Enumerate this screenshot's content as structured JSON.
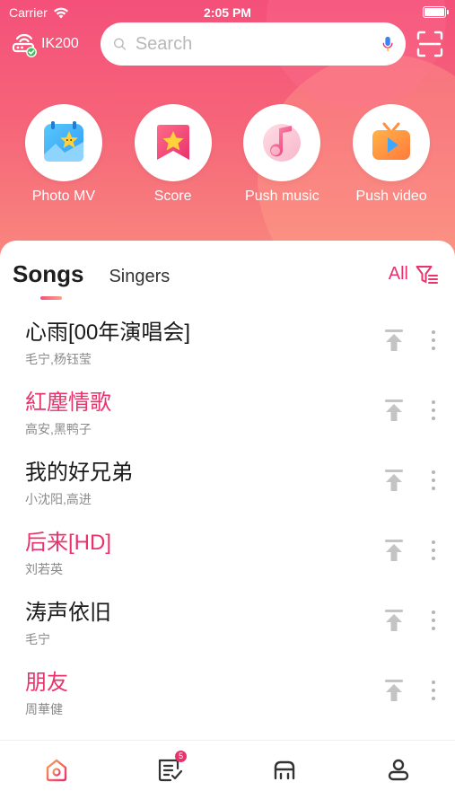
{
  "status_bar": {
    "carrier": "Carrier",
    "time": "2:05 PM"
  },
  "header": {
    "device_name": "IK200",
    "search_placeholder": "Search"
  },
  "quick_actions": [
    {
      "label": "Photo MV",
      "icon": "photo-mv-icon"
    },
    {
      "label": "Score",
      "icon": "score-icon"
    },
    {
      "label": "Push music",
      "icon": "push-music-icon"
    },
    {
      "label": "Push video",
      "icon": "push-video-icon"
    }
  ],
  "list_tabs": {
    "songs": "Songs",
    "singers": "Singers",
    "filter_label": "All"
  },
  "songs": [
    {
      "title": "心雨[00年演唱会]",
      "artist": "毛宁,杨钰莹",
      "highlight": false
    },
    {
      "title": "紅塵情歌",
      "artist": "高安,黑鸭子",
      "highlight": true
    },
    {
      "title": "我的好兄弟",
      "artist": "小沈阳,高进",
      "highlight": false
    },
    {
      "title": "后来[HD]",
      "artist": "刘若英",
      "highlight": true
    },
    {
      "title": "涛声依旧",
      "artist": "毛宁",
      "highlight": false
    },
    {
      "title": "朋友",
      "artist": "周華健",
      "highlight": true
    }
  ],
  "tab_bar": {
    "items": [
      "home-icon",
      "playlist-icon",
      "device-icon",
      "profile-icon"
    ],
    "playlist_badge": "5"
  },
  "colors": {
    "accent": "#e8336d",
    "hero_top": "#f4507a",
    "hero_bottom": "#f88a7e"
  }
}
